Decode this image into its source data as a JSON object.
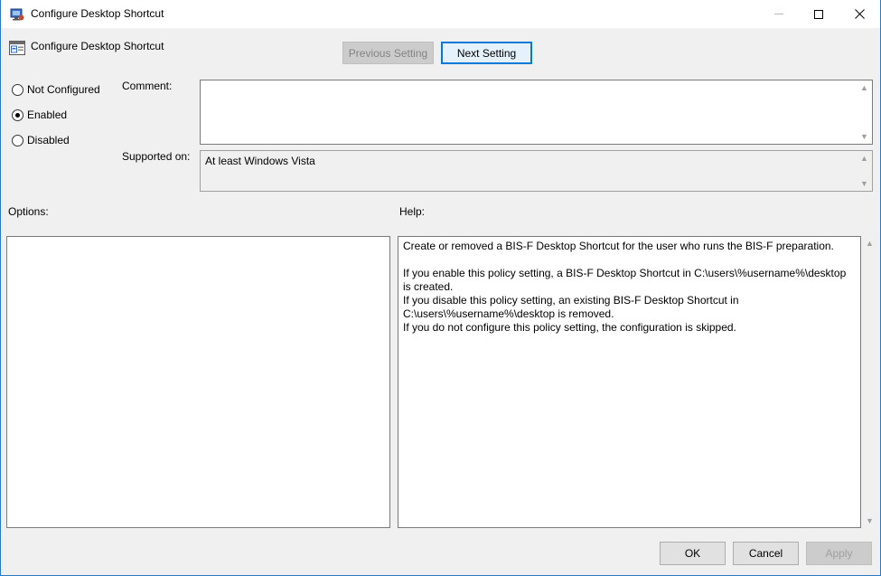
{
  "window": {
    "title": "Configure Desktop Shortcut"
  },
  "header": {
    "policy_name": "Configure Desktop Shortcut",
    "previous_label": "Previous Setting",
    "next_label": "Next Setting"
  },
  "state": {
    "options": [
      {
        "label": "Not Configured",
        "checked": false
      },
      {
        "label": "Enabled",
        "checked": true
      },
      {
        "label": "Disabled",
        "checked": false
      }
    ]
  },
  "comment": {
    "label": "Comment:",
    "value": ""
  },
  "supported": {
    "label": "Supported on:",
    "value": "At least Windows Vista"
  },
  "options_panel": {
    "label": "Options:"
  },
  "help_panel": {
    "label": "Help:",
    "paragraphs": [
      "Create or removed a BIS-F Desktop Shortcut for the user who runs the BIS-F preparation.",
      "",
      "If you enable this policy setting, a BIS-F Desktop Shortcut in C:\\users\\%username%\\desktop is created.",
      "If you disable this policy setting, an existing BIS-F Desktop Shortcut in C:\\users\\%username%\\desktop is removed.",
      "If you do not configure this policy setting, the configuration is skipped."
    ]
  },
  "footer": {
    "ok_label": "OK",
    "cancel_label": "Cancel",
    "apply_label": "Apply"
  }
}
